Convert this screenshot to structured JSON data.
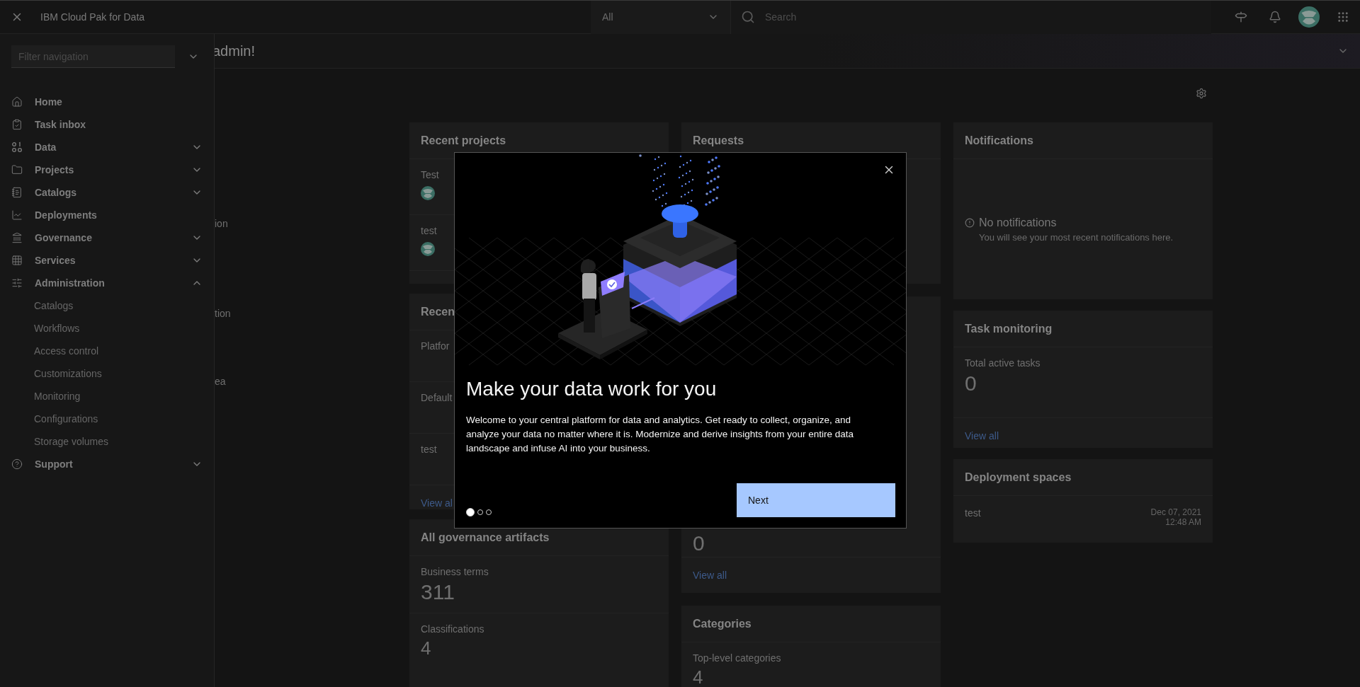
{
  "header": {
    "title": "IBM Cloud Pak for Data",
    "scope": {
      "value": "All"
    },
    "search": {
      "placeholder": "Search"
    }
  },
  "greeting": {
    "text": "admin!"
  },
  "page_fragments": [
    "ion",
    "tion",
    "ea"
  ],
  "nav": {
    "filter": {
      "placeholder": "Filter navigation"
    },
    "items": [
      {
        "label": "Home",
        "kind": "link"
      },
      {
        "label": "Task inbox",
        "kind": "link"
      },
      {
        "label": "Data",
        "kind": "group",
        "expanded": false
      },
      {
        "label": "Projects",
        "kind": "group",
        "expanded": false
      },
      {
        "label": "Catalogs",
        "kind": "group",
        "expanded": false
      },
      {
        "label": "Deployments",
        "kind": "link"
      },
      {
        "label": "Governance",
        "kind": "group",
        "expanded": false
      },
      {
        "label": "Services",
        "kind": "group",
        "expanded": false
      },
      {
        "label": "Administration",
        "kind": "group",
        "expanded": true,
        "children": [
          {
            "label": "Catalogs"
          },
          {
            "label": "Workflows"
          },
          {
            "label": "Access control"
          },
          {
            "label": "Customizations"
          },
          {
            "label": "Monitoring"
          },
          {
            "label": "Configurations"
          },
          {
            "label": "Storage volumes"
          }
        ]
      },
      {
        "label": "Support",
        "kind": "group",
        "expanded": false
      }
    ]
  },
  "dashboard": {
    "columns": [
      [
        {
          "kind": "projects",
          "title": "Recent projects",
          "rows": [
            {
              "name": "Test"
            },
            {
              "name": "test"
            }
          ]
        },
        {
          "kind": "list",
          "title": "Recen",
          "rows": [
            "Platfor",
            "Default",
            "test"
          ],
          "link": "View al"
        },
        {
          "kind": "stats",
          "title": "All governance artifacts",
          "stats": [
            {
              "label": "Business terms",
              "value": "311"
            },
            {
              "label": "Classifications",
              "value": "4"
            }
          ]
        }
      ],
      [
        {
          "kind": "plain",
          "title": "Requests"
        },
        {
          "kind": "tail",
          "value": "0",
          "link": "View all"
        },
        {
          "kind": "stats",
          "title": "Categories",
          "stats": [
            {
              "label": "Top-level categories",
              "value": "4"
            }
          ]
        }
      ],
      [
        {
          "kind": "empty",
          "title": "Notifications",
          "message": "No notifications",
          "detail": "You will see your most recent notifications here."
        },
        {
          "kind": "stats",
          "title": "Task monitoring",
          "stats": [
            {
              "label": "Total active tasks",
              "value": "0"
            }
          ],
          "link": "View all"
        },
        {
          "kind": "spaces",
          "title": "Deployment spaces",
          "rows": [
            {
              "name": "test",
              "date": "Dec 07, 2021",
              "time": "12:48 AM"
            }
          ]
        }
      ]
    ]
  },
  "modal": {
    "title": "Make your data work for you",
    "body": "Welcome to your central platform for data and analytics. Get ready to collect, organize, and analyze your data no matter where it is. Modernize and derive insights from your entire data landscape and infuse AI into your business.",
    "button": "Next",
    "pages": [
      {
        "selected": true
      },
      {
        "selected": false
      },
      {
        "selected": false
      }
    ]
  }
}
